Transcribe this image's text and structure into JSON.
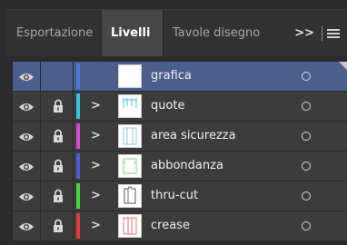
{
  "tabs": [
    {
      "label": "Esportazione",
      "active": false
    },
    {
      "label": "Livelli",
      "active": true
    },
    {
      "label": "Tavole disegno",
      "active": false
    }
  ],
  "overflow_label": ">>",
  "layers": [
    {
      "name": "grafica",
      "color": "#4a78d8",
      "selected": true,
      "locked": false,
      "expandable": false,
      "thumb": "blank"
    },
    {
      "name": "quote",
      "color": "#35c4e0",
      "selected": false,
      "locked": true,
      "expandable": true,
      "thumb": "quote"
    },
    {
      "name": "area sicurezza",
      "color": "#d24bd0",
      "selected": false,
      "locked": true,
      "expandable": true,
      "thumb": "area"
    },
    {
      "name": "abbondanza",
      "color": "#4c5bd6",
      "selected": false,
      "locked": true,
      "expandable": true,
      "thumb": "abbondanza"
    },
    {
      "name": "thru-cut",
      "color": "#3fd33f",
      "selected": false,
      "locked": true,
      "expandable": true,
      "thumb": "thru"
    },
    {
      "name": "crease",
      "color": "#e23b3b",
      "selected": false,
      "locked": true,
      "expandable": true,
      "thumb": "crease"
    }
  ]
}
